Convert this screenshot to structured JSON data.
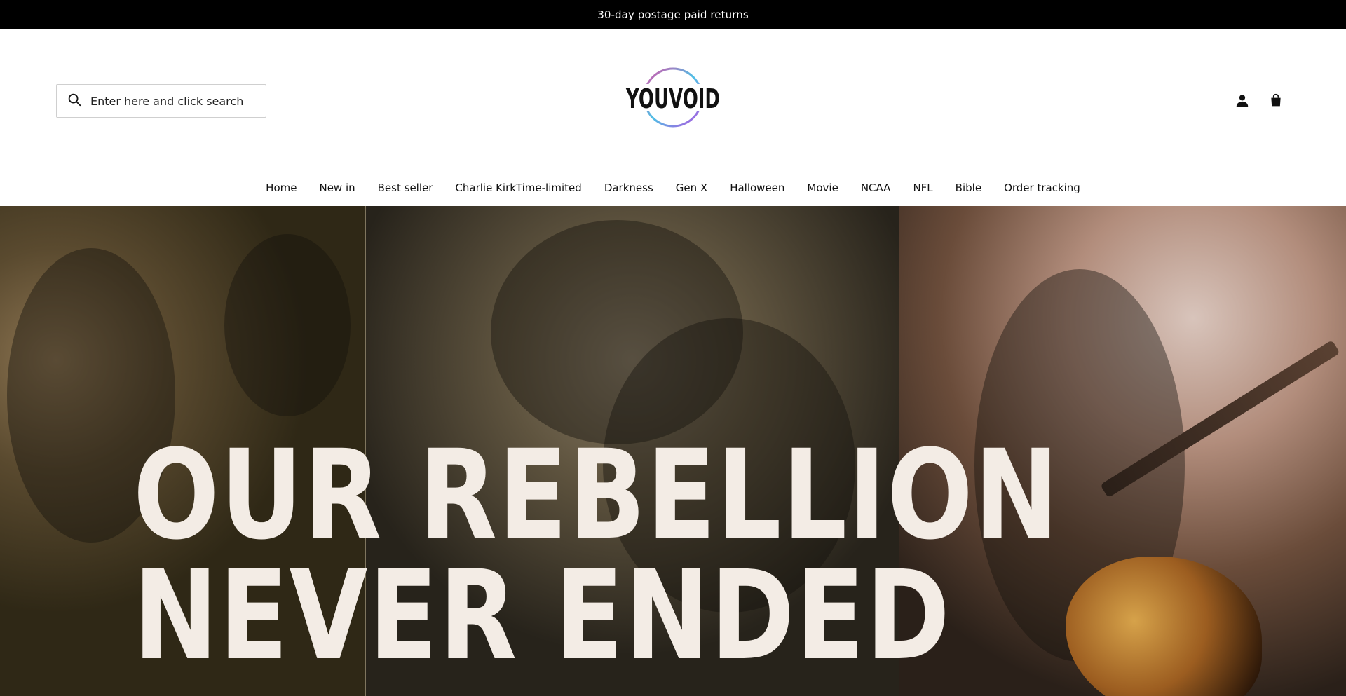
{
  "announcement": {
    "text": "30-day postage paid returns"
  },
  "header": {
    "search": {
      "placeholder": "Enter here and click search",
      "icon": "search-icon"
    },
    "logo": {
      "text": "YOUVOID",
      "colors": [
        "#e04ea6",
        "#4ec0e6",
        "#111111"
      ]
    },
    "icons": {
      "account": "account-icon",
      "cart": "cart-icon"
    }
  },
  "nav": {
    "items": [
      {
        "label": "Home"
      },
      {
        "label": "New in"
      },
      {
        "label": "Best seller"
      },
      {
        "label": "Charlie KirkTime-limited"
      },
      {
        "label": "Darkness"
      },
      {
        "label": "Gen X"
      },
      {
        "label": "Halloween"
      },
      {
        "label": "Movie"
      },
      {
        "label": "NCAA"
      },
      {
        "label": "NFL"
      },
      {
        "label": "Bible"
      },
      {
        "label": "Order tracking"
      }
    ]
  },
  "hero": {
    "title_line_1": "OUR REBELLION",
    "title_line_2": "NEVER ENDED",
    "colors": {
      "title": "#f3ece5"
    }
  }
}
